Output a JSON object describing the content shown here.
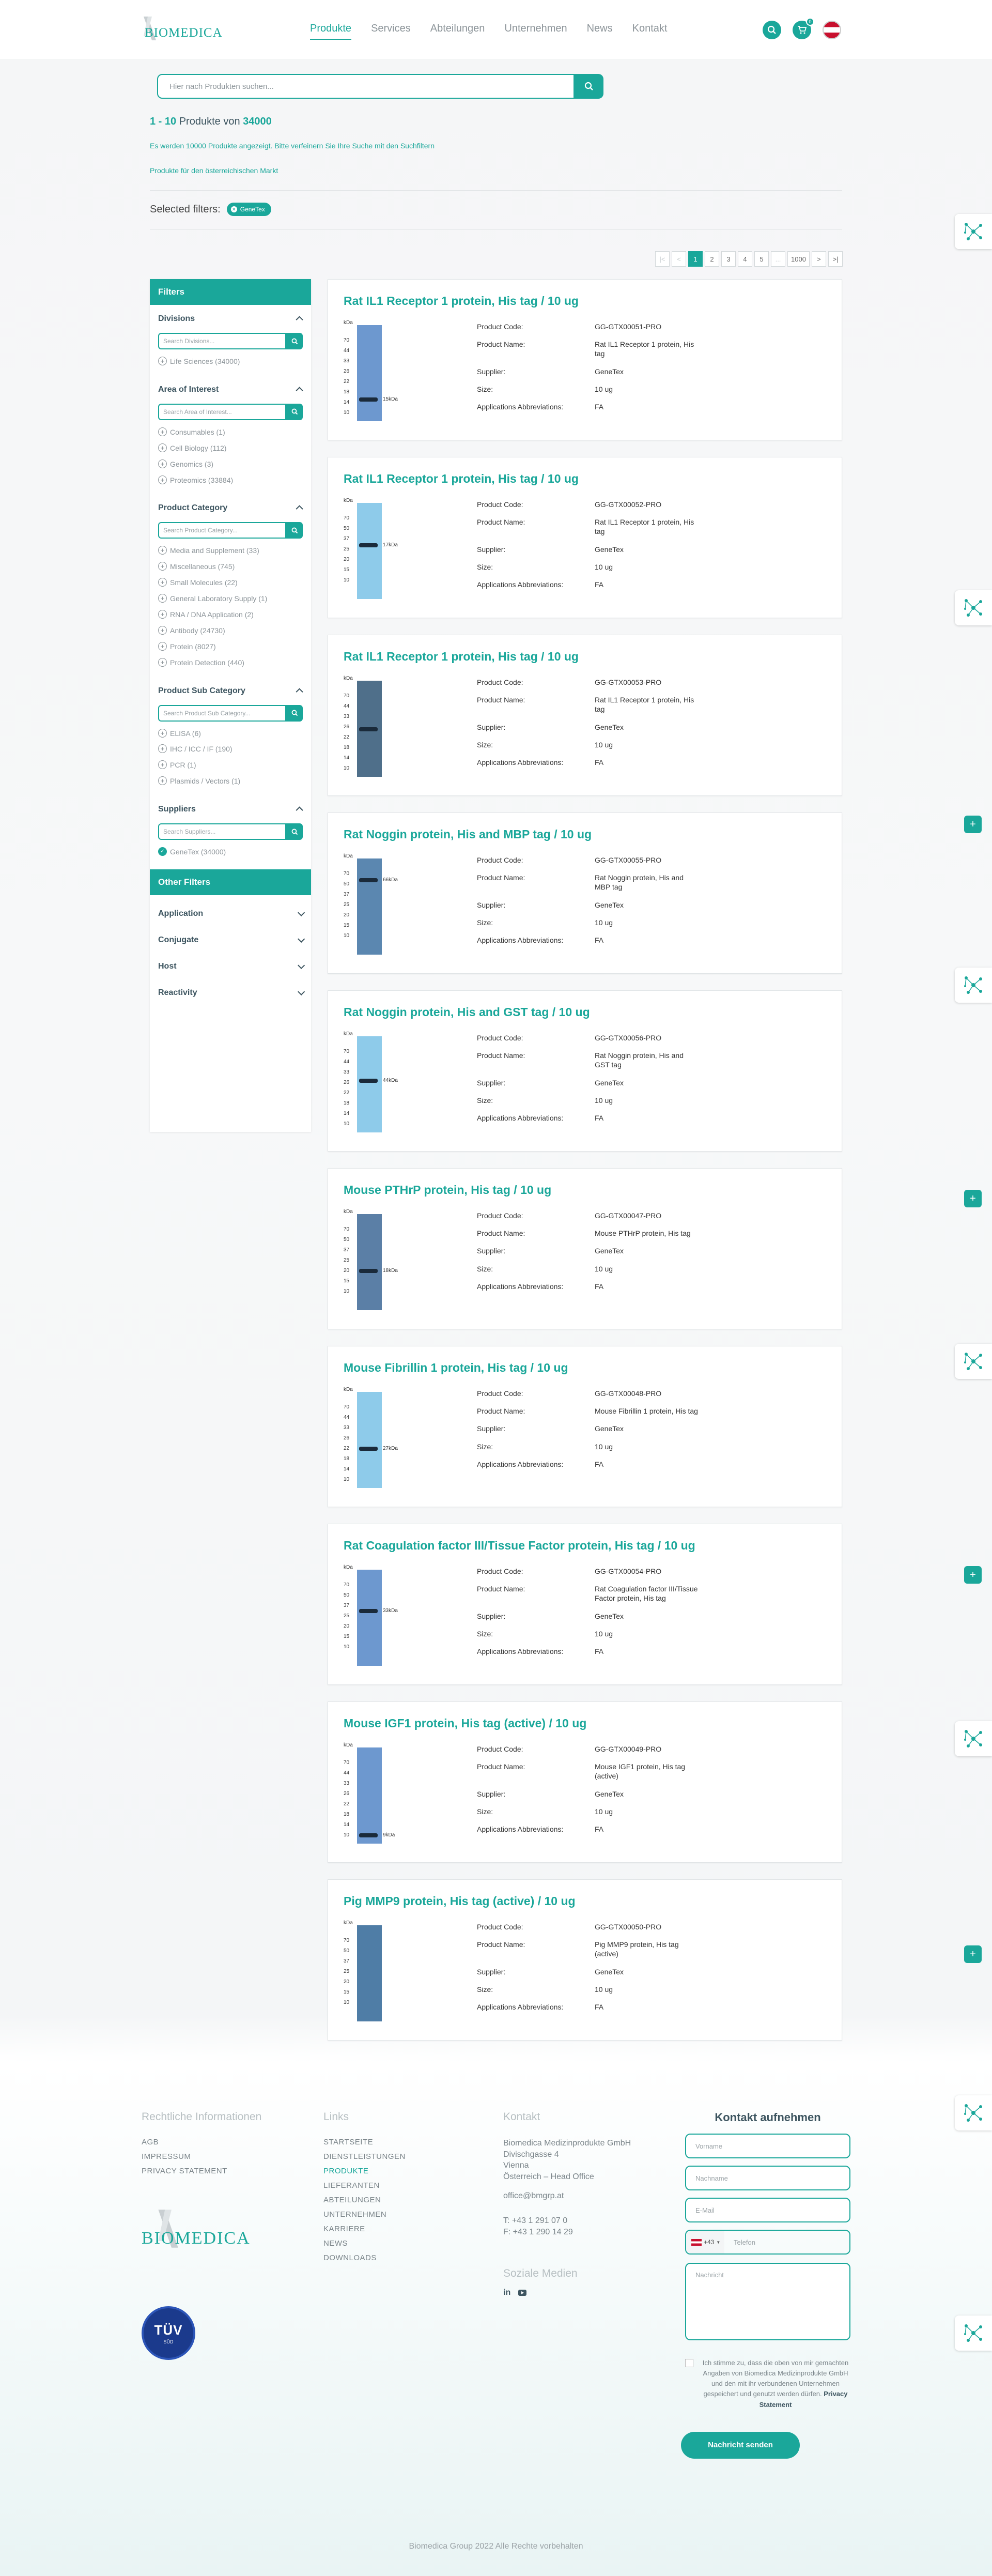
{
  "header": {
    "logo_text": "BIOMEDICA",
    "nav": [
      {
        "label": "Produkte",
        "active": true
      },
      {
        "label": "Services",
        "active": false
      },
      {
        "label": "Abteilungen",
        "active": false
      },
      {
        "label": "Unternehmen",
        "active": false
      },
      {
        "label": "News",
        "active": false
      },
      {
        "label": "Kontakt",
        "active": false
      }
    ],
    "cart_count": "0"
  },
  "search": {
    "placeholder": "Hier nach Produkten suchen..."
  },
  "results": {
    "range": "1 - 10",
    "mid": " Produkte von ",
    "total": "34000",
    "notice": "Es werden 10000 Produkte angezeigt. Bitte verfeinern Sie Ihre Suche mit den Suchfiltern",
    "market": "Produkte für den österreichischen Markt"
  },
  "selected_filters": {
    "label": "Selected filters:",
    "chips": [
      "GeneTex"
    ]
  },
  "pagination": [
    "|<",
    "<",
    "1",
    "2",
    "3",
    "4",
    "5",
    "...",
    "1000",
    ">",
    ">|"
  ],
  "sidebar": {
    "head": "Filters",
    "divisions": {
      "title": "Divisions",
      "placeholder": "Search Divisions...",
      "items": [
        "Life Sciences (34000)"
      ]
    },
    "area": {
      "title": "Area of Interest",
      "placeholder": "Search Area of Interest...",
      "items": [
        "Consumables (1)",
        "Cell Biology (112)",
        "Genomics (3)",
        "Proteomics (33884)"
      ]
    },
    "category": {
      "title": "Product Category",
      "placeholder": "Search Product Category...",
      "items": [
        "Media and Supplement (33)",
        "Miscellaneous (745)",
        "Small Molecules (22)",
        "General Laboratory Supply (1)",
        "RNA / DNA Application (2)",
        "Antibody (24730)",
        "Protein (8027)",
        "Protein Detection (440)"
      ]
    },
    "subcategory": {
      "title": "Product Sub Category",
      "placeholder": "Search Product Sub Category...",
      "items": [
        "ELISA (6)",
        "IHC / ICC / IF (190)",
        "PCR (1)",
        "Plasmids / Vectors (1)"
      ]
    },
    "suppliers": {
      "title": "Suppliers",
      "placeholder": "Search Suppliers...",
      "items": [
        "GeneTex (34000)"
      ]
    },
    "other_head": "Other Filters",
    "other": [
      "Application",
      "Conjugate",
      "Host",
      "Reactivity"
    ]
  },
  "spec_labels": {
    "code": "Product Code:",
    "name": "Product Name:",
    "supplier": "Supplier:",
    "size": "Size:",
    "apps": "Applications Abbreviations:"
  },
  "products": [
    {
      "title": "Rat IL1 Receptor 1 protein, His tag / 10 ug",
      "code": "GG-GTX00051-PRO",
      "name": "Rat IL1 Receptor 1 protein, His tag",
      "supplier": "GeneTex",
      "size": "10 ug",
      "apps": "FA",
      "marker": "15kDa",
      "lane_color": "#6d98cf"
    },
    {
      "title": "Rat IL1 Receptor 1 protein, His tag / 10 ug",
      "code": "GG-GTX00052-PRO",
      "name": "Rat IL1 Receptor 1 protein, His tag",
      "supplier": "GeneTex",
      "size": "10 ug",
      "apps": "FA",
      "marker": "17kDa",
      "lane_color": "#8ecbea"
    },
    {
      "title": "Rat IL1 Receptor 1 protein, His tag / 10 ug",
      "code": "GG-GTX00053-PRO",
      "name": "Rat IL1 Receptor 1 protein, His tag",
      "supplier": "GeneTex",
      "size": "10 ug",
      "apps": "FA",
      "marker": "",
      "lane_color": "#4f6f8a"
    },
    {
      "title": "Rat Noggin protein, His and MBP tag / 10 ug",
      "code": "GG-GTX00055-PRO",
      "name": "Rat Noggin protein, His and MBP tag",
      "supplier": "GeneTex",
      "size": "10 ug",
      "apps": "FA",
      "marker": "66kDa",
      "lane_color": "#5b87b0"
    },
    {
      "title": "Rat Noggin protein, His and GST tag / 10 ug",
      "code": "GG-GTX00056-PRO",
      "name": "Rat Noggin protein, His and GST tag",
      "supplier": "GeneTex",
      "size": "10 ug",
      "apps": "FA",
      "marker": "44kDa",
      "lane_color": "#8ecbea"
    },
    {
      "title": "Mouse PTHrP protein, His tag / 10 ug",
      "code": "GG-GTX00047-PRO",
      "name": "Mouse PTHrP protein, His tag",
      "supplier": "GeneTex",
      "size": "10 ug",
      "apps": "FA",
      "marker": "18kDa",
      "lane_color": "#5b7fa6"
    },
    {
      "title": "Mouse Fibrillin 1 protein, His tag / 10 ug",
      "code": "GG-GTX00048-PRO",
      "name": "Mouse Fibrillin 1 protein, His tag",
      "supplier": "GeneTex",
      "size": "10 ug",
      "apps": "FA",
      "marker": "27kDa",
      "lane_color": "#8ecbea"
    },
    {
      "title": "Rat Coagulation factor III/Tissue Factor protein, His tag / 10 ug",
      "code": "GG-GTX00054-PRO",
      "name": "Rat Coagulation factor III/Tissue Factor protein, His tag",
      "supplier": "GeneTex",
      "size": "10 ug",
      "apps": "FA",
      "marker": "33kDa",
      "lane_color": "#6d98cf"
    },
    {
      "title": "Mouse IGF1 protein, His tag (active) / 10 ug",
      "code": "GG-GTX00049-PRO",
      "name": "Mouse IGF1 protein, His tag (active)",
      "supplier": "GeneTex",
      "size": "10 ug",
      "apps": "FA",
      "marker": "9kDa",
      "lane_color": "#6d98cf"
    },
    {
      "title": "Pig MMP9 protein, His tag (active) / 10 ug",
      "code": "GG-GTX00050-PRO",
      "name": "Pig MMP9 protein, His tag (active)",
      "supplier": "GeneTex",
      "size": "10 ug",
      "apps": "FA",
      "marker": "",
      "lane_color": "#4f7da6"
    }
  ],
  "footer": {
    "legal": {
      "title": "Rechtliche Informationen",
      "links": [
        "AGB",
        "IMPRESSUM",
        "PRIVACY STATEMENT"
      ]
    },
    "links": {
      "title": "Links",
      "items": [
        "STARTSEITE",
        "DIENSTLEISTUNGEN",
        "PRODUKTE",
        "LIEFERANTEN",
        "ABTEILUNGEN",
        "UNTERNEHMEN",
        "KARRIERE",
        "NEWS",
        "DOWNLOADS"
      ]
    },
    "contact": {
      "title": "Kontakt",
      "company": "Biomedica Medizinprodukte GmbH",
      "street": "Divischgasse 4",
      "city": "Vienna",
      "country": "Österreich – Head Office",
      "email": "office@bmgrp.at",
      "tel": "T: +43 1 291 07 0",
      "fax": "F: +43 1 290 14 29"
    },
    "social_title": "Soziale Medien",
    "logo_text": "BIOMEDICA",
    "tuv": {
      "line1": "TÜV",
      "line2": "SÜD"
    },
    "form": {
      "title": "Kontakt aufnehmen",
      "vorname": "Vorname",
      "nachname": "Nachname",
      "email": "E-Mail",
      "prefix": "+43",
      "telefon": "Telefon",
      "nachricht": "Nachricht",
      "consent": "Ich stimme zu, dass die oben von mir gemachten Angaben von Biomedica Medizinprodukte GmbH und den mit ihr verbundenen Unternehmen gespeichert und genutzt werden dürfen.",
      "consent_link": "Privacy Statement",
      "submit": "Nachricht senden"
    },
    "copyright": "Biomedica Group 2022 Alle Rechte vorbehalten"
  }
}
